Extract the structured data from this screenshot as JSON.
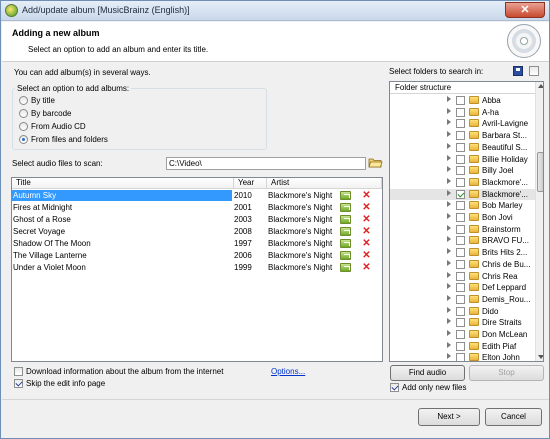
{
  "window": {
    "title": "Add/update album [MusicBrainz (English)]",
    "close_label": "✕"
  },
  "header": {
    "title": "Adding a new album",
    "subtitle": "Select an option to add an album and enter its title."
  },
  "intro_text": "You can add album(s) in several ways.",
  "options_group": {
    "label": "Select an option to add albums:",
    "options": [
      "By title",
      "By barcode",
      "From Audio CD",
      "From files and folders"
    ],
    "selected": "From files and folders"
  },
  "scan": {
    "label": "Select audio files to scan:",
    "path": "C:\\Video\\"
  },
  "file_list": {
    "columns": [
      "Title",
      "Year",
      "Artist"
    ],
    "rows": [
      {
        "title": "Autumn Sky",
        "year": "2010",
        "artist": "Blackmore's Night"
      },
      {
        "title": "Fires at Midnight",
        "year": "2001",
        "artist": "Blackmore's Night"
      },
      {
        "title": "Ghost of a Rose",
        "year": "2003",
        "artist": "Blackmore's Night"
      },
      {
        "title": "Secret Voyage",
        "year": "2008",
        "artist": "Blackmore's Night"
      },
      {
        "title": "Shadow Of The Moon",
        "year": "1997",
        "artist": "Blackmore's Night"
      },
      {
        "title": "The Village Lanterne",
        "year": "2006",
        "artist": "Blackmore's Night"
      },
      {
        "title": "Under a Violet Moon",
        "year": "1999",
        "artist": "Blackmore's Night"
      }
    ],
    "selected_index": 0
  },
  "download_info": {
    "label": "Download information about the album from the internet",
    "checked": false
  },
  "options_link": "Options...",
  "skip_edit": {
    "label": "Skip the edit info page",
    "checked": true
  },
  "folders": {
    "label": "Select folders to search in:",
    "tree_header": "Folder structure",
    "items": [
      {
        "name": "Abba",
        "checked": false
      },
      {
        "name": "A-ha",
        "checked": false
      },
      {
        "name": "Avril-Lavigne",
        "checked": false
      },
      {
        "name": "Barbara St...",
        "checked": false
      },
      {
        "name": "Beautiful S...",
        "checked": false
      },
      {
        "name": "Billie Holiday",
        "checked": false
      },
      {
        "name": "Billy Joel",
        "checked": false
      },
      {
        "name": "Blackmore'...",
        "checked": false
      },
      {
        "name": "Blackmore'...",
        "checked": true,
        "highlighted": true
      },
      {
        "name": "Bob Marley",
        "checked": false
      },
      {
        "name": "Bon Jovi",
        "checked": false
      },
      {
        "name": "Brainstorm",
        "checked": false
      },
      {
        "name": "BRAVO FU...",
        "checked": false
      },
      {
        "name": "Brits Hits 2...",
        "checked": false
      },
      {
        "name": "Chris de Bu...",
        "checked": false
      },
      {
        "name": "Chris Rea",
        "checked": false
      },
      {
        "name": "Def Leppard",
        "checked": false
      },
      {
        "name": "Demis_Rou...",
        "checked": false
      },
      {
        "name": "Dido",
        "checked": false
      },
      {
        "name": "Dire Straits",
        "checked": false
      },
      {
        "name": "Don McLean",
        "checked": false
      },
      {
        "name": "Edith Piaf",
        "checked": false
      },
      {
        "name": "Elton John",
        "checked": false
      }
    ]
  },
  "buttons": {
    "find_audio": "Find audio",
    "stop": "Stop",
    "next": "Next >",
    "cancel": "Cancel"
  },
  "add_only_new": {
    "label": "Add only new files",
    "checked": true
  }
}
